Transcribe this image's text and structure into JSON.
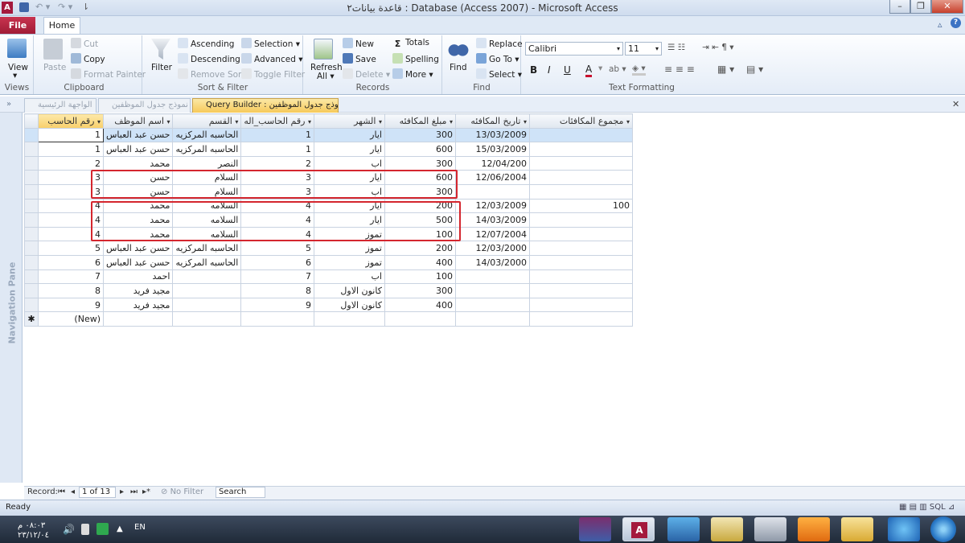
{
  "window": {
    "title": "قاعدة بيانات٢ : Database (Access 2007) - Microsoft Access",
    "minimize": "–",
    "restore": "❐",
    "close": "✕"
  },
  "ribbon": {
    "tabs": [
      "File",
      "Home"
    ],
    "views": {
      "view": "View",
      "label": "Views"
    },
    "clipboard": {
      "paste": "Paste",
      "cut": "Cut",
      "copy": "Copy",
      "format_painter": "Format Painter",
      "label": "Clipboard"
    },
    "sort_filter": {
      "filter": "Filter",
      "ascending": "Ascending",
      "descending": "Descending",
      "remove_sort": "Remove Sort",
      "selection": "Selection ▾",
      "advanced": "Advanced ▾",
      "toggle_filter": "Toggle Filter",
      "label": "Sort & Filter"
    },
    "records": {
      "refresh": "Refresh",
      "refresh2": "All ▾",
      "new": "New",
      "save": "Save",
      "delete": "Delete ▾",
      "totals": "Totals",
      "spelling": "Spelling",
      "more": "More ▾",
      "label": "Records"
    },
    "find": {
      "find": "Find",
      "replace": "Replace",
      "goto": "Go To ▾",
      "select": "Select ▾",
      "label": "Find"
    },
    "text_formatting": {
      "font": "Calibri",
      "size": "11",
      "label": "Text Formatting"
    }
  },
  "doc_tabs": [
    "الواجهة الرئيسية",
    "نموذج جدول الموظفين",
    "Query Builder : نموذج جدول الموظفين"
  ],
  "navigation_pane": "Navigation Pane",
  "columns": [
    "رقم الحاسب",
    "اسم الموظف",
    "القسم",
    "رقم الحاسب_اله",
    "الشهر",
    "مبلغ المكافئه",
    "تاريخ المكافئه",
    "مجموع المكافئات"
  ],
  "rows": [
    [
      "1",
      "حسن عبد العباس",
      "الحاسبه المركزيه",
      "1",
      "ايار",
      "300",
      "13/03/2009",
      ""
    ],
    [
      "1",
      "حسن عبد العباس",
      "الحاسبه المركزيه",
      "1",
      "ايار",
      "600",
      "15/03/2009",
      ""
    ],
    [
      "2",
      "محمد",
      "النصر",
      "2",
      "اب",
      "300",
      "12/04/200",
      ""
    ],
    [
      "3",
      "حسن",
      "السلام",
      "3",
      "ايار",
      "600",
      "12/06/2004",
      ""
    ],
    [
      "3",
      "حسن",
      "السلام",
      "3",
      "اب",
      "300",
      "",
      ""
    ],
    [
      "4",
      "محمد",
      "السلامه",
      "4",
      "ايار",
      "200",
      "12/03/2009",
      "100"
    ],
    [
      "4",
      "محمد",
      "السلامه",
      "4",
      "ايار",
      "500",
      "14/03/2009",
      ""
    ],
    [
      "4",
      "محمد",
      "السلامه",
      "4",
      "تموز",
      "100",
      "12/07/2004",
      ""
    ],
    [
      "5",
      "حسن عبد العباس",
      "الحاسبه المركزيه",
      "5",
      "تموز",
      "200",
      "12/03/2000",
      ""
    ],
    [
      "6",
      "حسن عبد العباس",
      "الحاسبه المركزيه",
      "6",
      "تموز",
      "400",
      "14/03/2000",
      ""
    ],
    [
      "7",
      "احمد",
      "",
      "7",
      "اب",
      "100",
      "",
      ""
    ],
    [
      "8",
      "مجيد فريد",
      "",
      "8",
      "كانون الاول",
      "300",
      "",
      ""
    ],
    [
      "9",
      "مجيد فريد",
      "",
      "9",
      "كانون الاول",
      "400",
      "",
      ""
    ]
  ],
  "new_row": "(New)",
  "record_nav": {
    "label": "Record:",
    "position": "1 of 13",
    "no_filter": "No Filter",
    "search": "Search"
  },
  "status": "Ready",
  "taskbar": {
    "time": "٠٨:٠٣ م",
    "date": "٢٣/١٢/٠٤",
    "lang": "EN"
  }
}
